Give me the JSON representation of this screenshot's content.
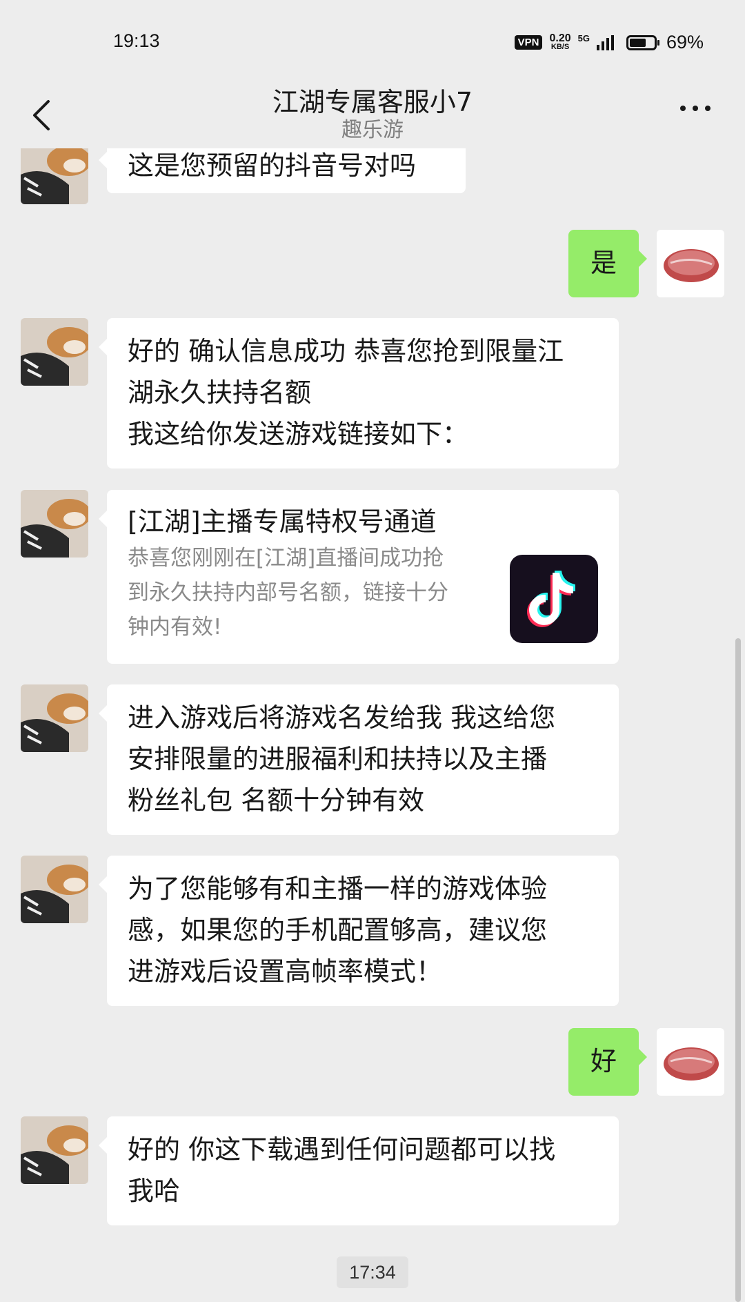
{
  "status_bar": {
    "time": "19:13",
    "vpn": "VPN",
    "speed_value": "0.20",
    "speed_unit": "KB/S",
    "network": "5G",
    "battery_percent": "69%",
    "battery_level": 0.69
  },
  "header": {
    "title": "江湖专属客服小7",
    "subtitle": "趣乐游"
  },
  "messages": [
    {
      "side": "left",
      "lines": [
        "这是您预留的抖音号对吗"
      ]
    },
    {
      "side": "right",
      "lines": [
        "是"
      ]
    },
    {
      "side": "left",
      "lines": [
        "好的 确认信息成功 恭喜您抢到限量江",
        "湖永久扶持名额",
        "我这给你发送游戏链接如下："
      ]
    },
    {
      "side": "left",
      "type": "card",
      "title": "[江湖]主播专属特权号通道",
      "desc_lines": [
        "恭喜您刚刚在[江湖]直播间成功抢",
        "到永久扶持内部号名额，链接十分",
        "钟内有效!"
      ],
      "logo": "tiktok-logo-icon"
    },
    {
      "side": "left",
      "lines": [
        "进入游戏后将游戏名发给我 我这给您",
        "安排限量的进服福利和扶持以及主播",
        "粉丝礼包 名额十分钟有效"
      ]
    },
    {
      "side": "left",
      "lines": [
        "为了您能够有和主播一样的游戏体验",
        "感，如果您的手机配置够高，建议您",
        "进游戏后设置高帧率模式！"
      ]
    },
    {
      "side": "right",
      "lines": [
        "好"
      ]
    },
    {
      "side": "left",
      "lines": [
        "好的 你这下载遇到任何问题都可以找",
        "我哈"
      ]
    }
  ],
  "timestamp": "17:34",
  "colors": {
    "background": "#ededed",
    "bubble_right": "#95ec69",
    "bubble_left": "#ffffff"
  }
}
